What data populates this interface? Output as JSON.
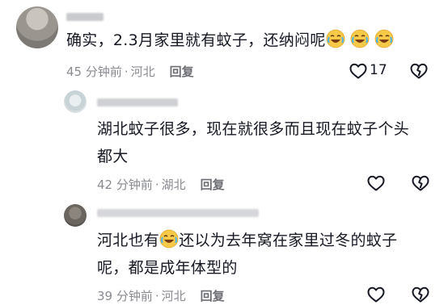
{
  "comments": [
    {
      "content_text": "确实，2.3月家里就有蚊子，还纳闷呢",
      "emoji_count": 3,
      "time": "45 分钟前",
      "separator": "·",
      "location": "河北",
      "reply_label": "回复",
      "like_count": "17"
    }
  ],
  "replies": [
    {
      "content_line1": "湖北蚊子很多，现在就很多而且现在蚊子个头",
      "content_line2": "都大",
      "time": "42 分钟前",
      "separator": "·",
      "location": "湖北",
      "reply_label": "回复"
    },
    {
      "content_part1": "河北也有",
      "content_part2": "还以为去年窝在家里过冬的蚊子",
      "content_line2": "呢，都是成年体型的",
      "time": "39 分钟前",
      "separator": "·",
      "location": "河北",
      "reply_label": "回复"
    }
  ],
  "colors": {
    "text": "#161823",
    "meta": "#8a8b91",
    "emoji_face": "#f7c948"
  },
  "icons": [
    "heart-outline-icon",
    "dislike-broken-heart-icon",
    "crying-laughing-emoji-icon"
  ]
}
